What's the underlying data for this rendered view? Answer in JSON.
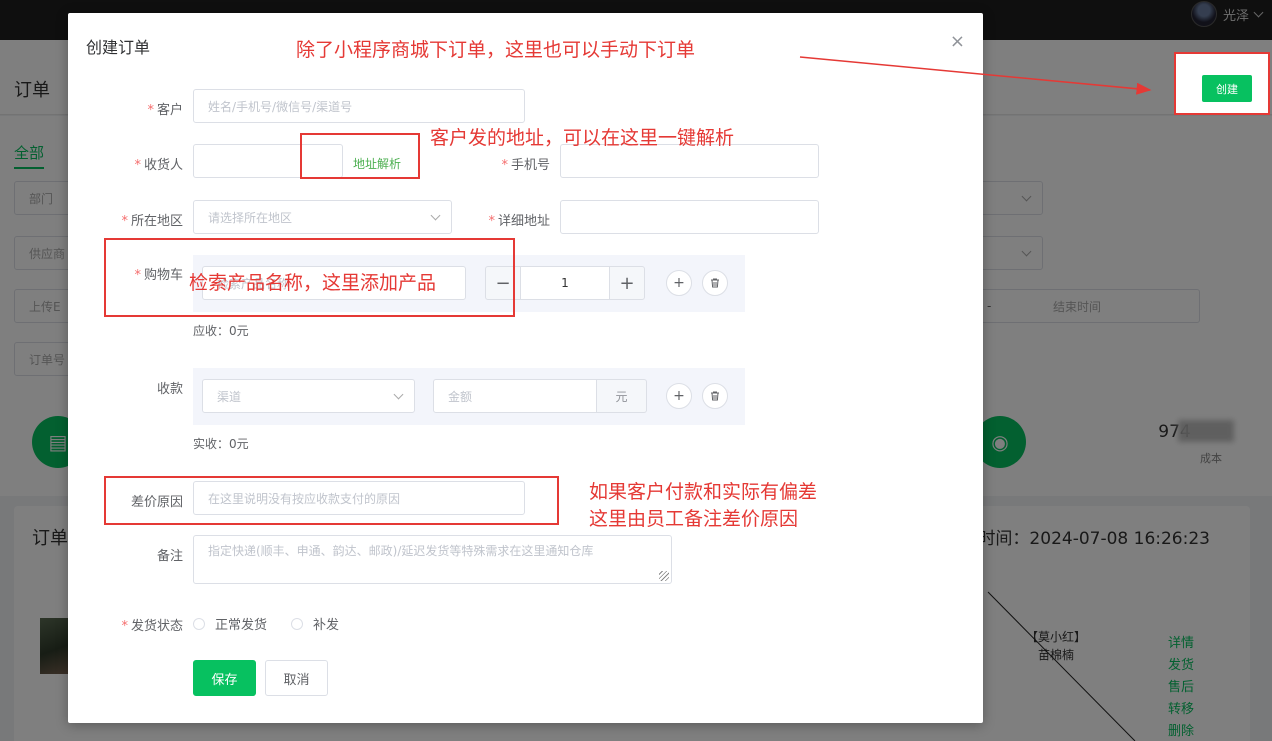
{
  "header": {
    "user_name": "光泽",
    "create_button": "创建"
  },
  "background": {
    "page_title": "订单",
    "tab_all": "全部",
    "filters": {
      "dept": "部门",
      "supplier": "供应商",
      "upload": "上传E",
      "order_no": "订单号",
      "end_time": "结束时间",
      "range_sep": "-"
    },
    "stats": {
      "value_visible": "974",
      "blurred_suffix": "0",
      "label": "成本"
    },
    "order": {
      "title": "订单",
      "time": "时间：2024-07-08 16:26:23",
      "customer_line1": "【莫小红】",
      "customer_line2": "苗棉楠",
      "actions": [
        "详情",
        "发货",
        "售后",
        "转移",
        "删除"
      ]
    }
  },
  "dialog": {
    "title": "创建订单",
    "close": "×",
    "customer": {
      "label": "客户",
      "placeholder": "姓名/手机号/微信号/渠道号"
    },
    "receiver": {
      "label": "收货人",
      "value": "",
      "parse_link": "地址解析"
    },
    "phone": {
      "label": "手机号",
      "value": ""
    },
    "region": {
      "label": "所在地区",
      "placeholder": "请选择所在地区"
    },
    "address": {
      "label": "详细地址",
      "value": ""
    },
    "cart": {
      "label": "购物车",
      "product_placeholder": "检索产品名称",
      "qty": "1",
      "minus": "−",
      "plus": "+",
      "add": "+",
      "delete_icon": "trash"
    },
    "receivable": "应收：0元",
    "payment": {
      "label": "收款",
      "channel_placeholder": "渠道",
      "amount_placeholder": "金额",
      "unit": "元"
    },
    "received": "实收：0元",
    "diff_reason": {
      "label": "差价原因",
      "placeholder": "在这里说明没有按应收款支付的原因"
    },
    "remark": {
      "label": "备注",
      "placeholder": "指定快递(顺丰、申通、韵达、邮政)/延迟发货等特殊需求在这里通知仓库"
    },
    "ship_status": {
      "label": "发货状态",
      "options": [
        "正常发货",
        "补发"
      ]
    },
    "save": "保存",
    "cancel": "取消"
  },
  "annotations": {
    "top": "除了小程序商城下订单，这里也可以手动下订单",
    "address": "客户发的地址，可以在这里一键解析",
    "cart": "检索产品名称，这里添加产品",
    "diff_line1": "如果客户付款和实际有偏差",
    "diff_line2": "这里由员工备注差价原因"
  },
  "colors": {
    "accent": "#07c160",
    "annotation": "#e53935",
    "required": "#f56c6c"
  }
}
